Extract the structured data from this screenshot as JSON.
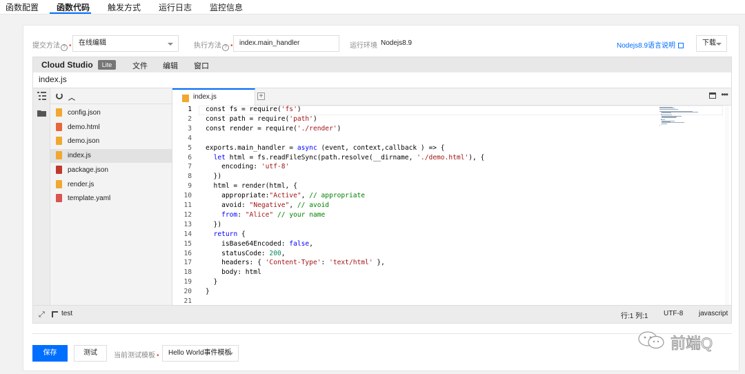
{
  "top_tabs": [
    {
      "label": "函数配置"
    },
    {
      "label": "函数代码"
    },
    {
      "label": "触发方式"
    },
    {
      "label": "运行日志"
    },
    {
      "label": "监控信息"
    }
  ],
  "active_tab": "函数代码",
  "form": {
    "submit_method_label": "提交方法",
    "submit_method_value": "在线编辑",
    "exec_method_label": "执行方法",
    "exec_method_value": "index.main_handler",
    "runtime_label": "运行环境",
    "runtime_value": "Nodejs8.9",
    "doc_link": "Nodejs8.9语言说明",
    "download_label": "下载"
  },
  "ide": {
    "brand": "Cloud Studio",
    "badge": "Lite",
    "menu": [
      "文件",
      "编辑",
      "窗口"
    ],
    "open_file_title": "index.js",
    "tab_label": "index.js",
    "files": [
      {
        "name": "config.json",
        "icon": "json-file-icon"
      },
      {
        "name": "demo.html",
        "icon": "html-file-icon"
      },
      {
        "name": "demo.json",
        "icon": "json-file-icon"
      },
      {
        "name": "index.js",
        "icon": "js-file-icon",
        "selected": true
      },
      {
        "name": "package.json",
        "icon": "npm-file-icon"
      },
      {
        "name": "render.js",
        "icon": "js-file-icon"
      },
      {
        "name": "template.yaml",
        "icon": "yaml-file-icon"
      }
    ],
    "code_lines": [
      [
        [
          "txt",
          "const fs = require("
        ],
        [
          "str",
          "'fs'"
        ],
        [
          "txt",
          ")"
        ]
      ],
      [
        [
          "txt",
          "const path = require("
        ],
        [
          "str",
          "'path'"
        ],
        [
          "txt",
          ")"
        ]
      ],
      [
        [
          "txt",
          "const render = require("
        ],
        [
          "str",
          "'./render'"
        ],
        [
          "txt",
          ")"
        ]
      ],
      [],
      [
        [
          "txt",
          "exports.main_handler = "
        ],
        [
          "kw",
          "async"
        ],
        [
          "txt",
          " (event, context,callback ) => {"
        ]
      ],
      [
        [
          "txt",
          "  "
        ],
        [
          "kw",
          "let"
        ],
        [
          "txt",
          " html = fs.readFileSync(path.resolve(__dirname, "
        ],
        [
          "str",
          "'./demo.html'"
        ],
        [
          "txt",
          "), {"
        ]
      ],
      [
        [
          "txt",
          "    encoding: "
        ],
        [
          "str",
          "'utf-8'"
        ]
      ],
      [
        [
          "txt",
          "  })"
        ]
      ],
      [
        [
          "txt",
          "  html = render(html, {"
        ]
      ],
      [
        [
          "txt",
          "    appropriate:"
        ],
        [
          "str",
          "\"Active\""
        ],
        [
          "txt",
          ", "
        ],
        [
          "cm",
          "// appropriate"
        ]
      ],
      [
        [
          "txt",
          "    avoid: "
        ],
        [
          "str",
          "\"Negative\""
        ],
        [
          "txt",
          ", "
        ],
        [
          "cm",
          "// avoid"
        ]
      ],
      [
        [
          "txt",
          "    "
        ],
        [
          "kw",
          "from"
        ],
        [
          "txt",
          ": "
        ],
        [
          "str",
          "\"Alice\""
        ],
        [
          "txt",
          " "
        ],
        [
          "cm",
          "// your name"
        ]
      ],
      [
        [
          "txt",
          "  })"
        ]
      ],
      [
        [
          "txt",
          "  "
        ],
        [
          "kw",
          "return"
        ],
        [
          "txt",
          " {"
        ]
      ],
      [
        [
          "txt",
          "    isBase64Encoded: "
        ],
        [
          "kw",
          "false"
        ],
        [
          "txt",
          ","
        ]
      ],
      [
        [
          "txt",
          "    statusCode: "
        ],
        [
          "num",
          "200"
        ],
        [
          "txt",
          ","
        ]
      ],
      [
        [
          "txt",
          "    headers: { "
        ],
        [
          "str",
          "'Content-Type'"
        ],
        [
          "txt",
          ": "
        ],
        [
          "str",
          "'text/html'"
        ],
        [
          "txt",
          " },"
        ]
      ],
      [
        [
          "txt",
          "    body: html"
        ]
      ],
      [
        [
          "txt",
          "  }"
        ]
      ],
      [
        [
          "txt",
          "}"
        ]
      ],
      []
    ],
    "status": {
      "test_label": "test",
      "position": "行:1 列:1",
      "encoding": "UTF-8",
      "language": "javascript"
    }
  },
  "bottom": {
    "save_label": "保存",
    "test_label": "测试",
    "template_label": "当前测试模板",
    "template_value": "Hello World事件模板"
  },
  "watermark": {
    "text": "前端Q"
  },
  "colors": {
    "accent": "#006eff",
    "required": "#e1504a"
  }
}
